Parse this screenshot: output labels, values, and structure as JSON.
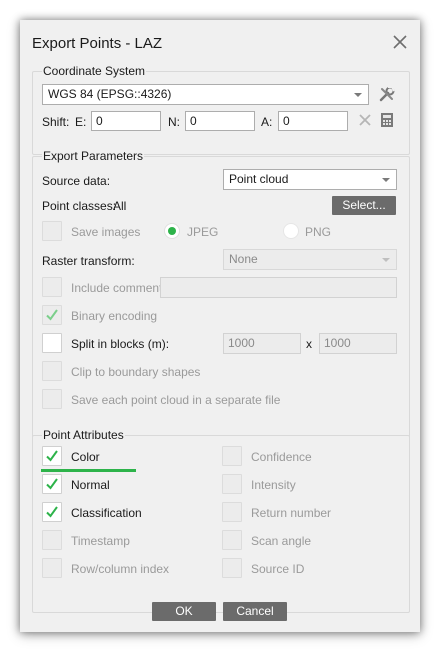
{
  "dialog": {
    "title": "Export Points - LAZ",
    "close_icon": "close-icon"
  },
  "coordinate_system": {
    "label": "Coordinate System",
    "crs_value": "WGS 84 (EPSG::4326)",
    "shift_label": "Shift:",
    "e_label": "E:",
    "e_value": "0",
    "n_label": "N:",
    "n_value": "0",
    "a_label": "A:",
    "a_value": "0",
    "icons": [
      "settings-icon",
      "clear-icon",
      "calculator-icon"
    ]
  },
  "export_parameters": {
    "label": "Export Parameters",
    "source_data_label": "Source data:",
    "source_data_value": "Point cloud",
    "point_classes_label": "Point classes:",
    "point_classes_value": "All",
    "select_button": "Select...",
    "save_images_label": "Save images",
    "save_images_checked": false,
    "jpeg_label": "JPEG",
    "png_label": "PNG",
    "selected_format": "JPEG",
    "raster_transform_label": "Raster transform:",
    "raster_transform_value": "None",
    "include_comment_label": "Include comment",
    "include_comment_checked": false,
    "comment_value": "",
    "binary_encoding_label": "Binary encoding",
    "binary_encoding_checked": true,
    "split_blocks_label": "Split in blocks (m):",
    "split_blocks_checked": false,
    "block_x": "1000",
    "block_sep": "x",
    "block_y": "1000",
    "clip_label": "Clip to boundary shapes",
    "clip_checked": false,
    "separate_file_label": "Save each point cloud in a separate file",
    "separate_file_checked": false
  },
  "point_attributes": {
    "label": "Point Attributes",
    "left": [
      {
        "label": "Color",
        "checked": true,
        "enabled": true
      },
      {
        "label": "Normal",
        "checked": true,
        "enabled": true
      },
      {
        "label": "Classification",
        "checked": true,
        "enabled": true
      },
      {
        "label": "Timestamp",
        "checked": false,
        "enabled": false
      },
      {
        "label": "Row/column index",
        "checked": false,
        "enabled": false
      }
    ],
    "right": [
      {
        "label": "Confidence",
        "checked": false,
        "enabled": false
      },
      {
        "label": "Intensity",
        "checked": false,
        "enabled": false
      },
      {
        "label": "Return number",
        "checked": false,
        "enabled": false
      },
      {
        "label": "Scan angle",
        "checked": false,
        "enabled": false
      },
      {
        "label": "Source ID",
        "checked": false,
        "enabled": false
      }
    ]
  },
  "buttons": {
    "ok": "OK",
    "cancel": "Cancel"
  },
  "colors": {
    "accent_green": "#2db34a",
    "button_gray": "#6b6b6b"
  }
}
